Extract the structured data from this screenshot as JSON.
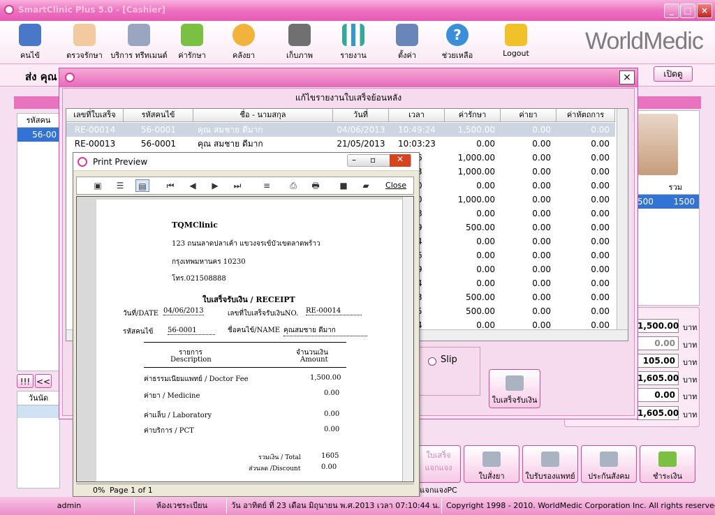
{
  "window": {
    "title": "SmartClinic Plus 5.0 - [Cashier]",
    "min": "_",
    "max": "□",
    "close": "×"
  },
  "toolbar": [
    {
      "label": "คนไข้",
      "icon": "patient-icon"
    },
    {
      "label": "ตรวจรักษา",
      "icon": "doctor-icon"
    },
    {
      "label": "บริการ ทรีทเมนต์",
      "icon": "treatment-mask-icon"
    },
    {
      "label": "ค่ารักษา",
      "icon": "money-icon"
    },
    {
      "label": "คลังยา",
      "icon": "pill-icon"
    },
    {
      "label": "เก็บภาพ",
      "icon": "camera-icon"
    },
    {
      "label": "รายงาน",
      "icon": "report-chart-icon"
    },
    {
      "label": "ตั้งค่า",
      "icon": "settings-tools-icon"
    },
    {
      "label": "ช่วยเหลือ",
      "icon": "help-icon"
    },
    {
      "label": "Logout",
      "icon": "lock-icon"
    }
  ],
  "brand": "WorldMedic",
  "sub_header": {
    "label": "ส่ง คุณ",
    "open_button": "เปิดดู"
  },
  "left_panel": {
    "header": "รหัสคน",
    "row": "56-00",
    "nav": [
      "!!!",
      "<<"
    ],
    "date_header": "วันนัด"
  },
  "dialog": {
    "caption": "แก้ไขรายงานใบเสร็จย้อนหลัง",
    "columns": [
      "เลขที่ใบเสร็จ",
      "รหัสคนไข้",
      "ชื่อ - นามสกุล",
      "วันที่",
      "เวลา",
      "ค่ารักษา",
      "ค่ายา",
      "ค่าหัตถการ"
    ],
    "rows": [
      {
        "receipt": "RE-00014",
        "patient": "56-0001",
        "name": "คุณ สมชาย   ดีมาก",
        "date": "04/06/2013",
        "time": "10:49:24",
        "fee": "1,500.00",
        "medicine": "0.00",
        "procedure": "0.00",
        "selected": true
      },
      {
        "receipt": "RE-00013",
        "patient": "56-0001",
        "name": "คุณ สมชาย   ดีมาก",
        "date": "21/05/2013",
        "time": "10:03:23",
        "fee": "0.00",
        "medicine": "0.00",
        "procedure": "0.00"
      },
      {
        "time": "06",
        "fee": "1,000.00",
        "medicine": "0.00",
        "procedure": "0.00"
      },
      {
        "time": "43",
        "fee": "1,000.00",
        "medicine": "0.00",
        "procedure": "0.00"
      },
      {
        "time": "50",
        "fee": "0.00",
        "medicine": "0.00",
        "procedure": "0.00"
      },
      {
        "time": "10",
        "fee": "1,000.00",
        "medicine": "0.00",
        "procedure": "0.00"
      },
      {
        "time": "18",
        "fee": "0.00",
        "medicine": "0.00",
        "procedure": "0.00"
      },
      {
        "time": "59",
        "fee": "500.00",
        "medicine": "0.00",
        "procedure": "0.00"
      },
      {
        "time": "24",
        "fee": "0.00",
        "medicine": "0.00",
        "procedure": "0.00"
      },
      {
        "time": "56",
        "fee": "0.00",
        "medicine": "0.00",
        "procedure": "0.00"
      },
      {
        "time": "09",
        "fee": "0.00",
        "medicine": "0.00",
        "procedure": "0.00"
      },
      {
        "time": "44",
        "fee": "0.00",
        "medicine": "0.00",
        "procedure": "0.00"
      },
      {
        "time": "43",
        "fee": "500.00",
        "medicine": "0.00",
        "procedure": "0.00"
      },
      {
        "time": "05",
        "fee": "500.00",
        "medicine": "0.00",
        "procedure": "0.00"
      },
      {
        "time": "14",
        "fee": "0.00",
        "medicine": "0.00",
        "procedure": "0.00"
      }
    ],
    "slip_label": "Slip",
    "receipt_button": "ใบเสร็จรับเงิน"
  },
  "preview": {
    "title": "Print Preview",
    "close_label": "Close",
    "zoom": "0%",
    "page": "Page 1 of 1",
    "receipt": {
      "clinic": "TQMClinic",
      "addr1": "123 ถนนลาดปลาเค้า แขวงจรเข้บัวเขตลาดพร้าว",
      "addr2": "กรุงเทพมหานคร 10230",
      "tel": "โทร.021508888",
      "heading": "ใบเสร็จรับเงิน / RECEIPT",
      "date_label": "วันที่/DATE",
      "date": "04/06/2013",
      "no_label": "เลขที่ใบเสร็จรับเงินNO.",
      "no": "RE-00014",
      "pid_label": "รหัสคนไข้",
      "pid": "56-0001",
      "name_label": "ชื่อคนไข้/NAME",
      "name": "คุณสมชาย ดีมาก",
      "col1a": "รายการ",
      "col1b": "Description",
      "col2a": "จำนวนเงิน",
      "col2b": "Amount",
      "items": [
        {
          "desc": "ค่าธรรมเนียมแพทย์ / Doctor Fee",
          "amt": "1,500.00"
        },
        {
          "desc": "ค่ายา / Medicine",
          "amt": "0.00"
        },
        {
          "desc": "ค่าแล็บ / Laboratory",
          "amt": "0.00"
        },
        {
          "desc": "ค่าบริการ / PCT",
          "amt": "0.00"
        }
      ],
      "total_label": "รวมเงิน / Total",
      "total": "1605",
      "discount_label": "ส่วนลด /Discount",
      "discount": "0.00"
    }
  },
  "right_panel": {
    "total_header": "รวม",
    "row_a": "500",
    "row_b": "1500",
    "amounts": [
      "1,500.00",
      "0.00",
      "105.00",
      "1,605.00",
      "0.00",
      "1,605.00"
    ],
    "unit": "บาท"
  },
  "bottom_buttons": [
    "ใบเสร็จแจกแจง",
    "แจกแจงPC",
    "ใบสั่งยา",
    "ใบรับรองแพทย์",
    "ประกันสังคม",
    "ชำระเงิน"
  ],
  "statusbar": {
    "user": "admin",
    "room": "ห้องเวชระเบียน",
    "datetime": "วัน อาทิตย์ ที่ 23 เดือน มิถุนายน พ.ศ.2013 เวลา 07:10:44 น.",
    "copyright": "Copyright 1998 - 2010. WorldMedic Corporation Inc. All rights reserved."
  }
}
